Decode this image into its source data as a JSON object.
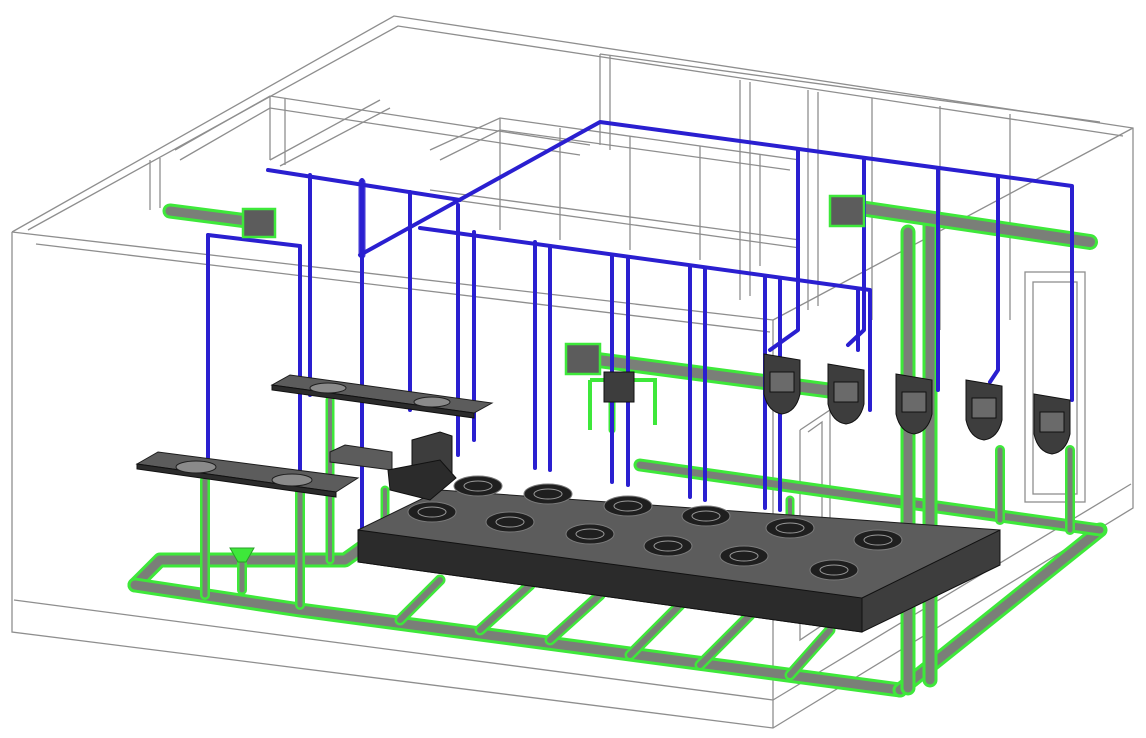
{
  "colors": {
    "background": "#ffffff",
    "wireframe": "#8e8e8e",
    "supply_pipe": "#2a1fd0",
    "drain_pipe_outline": "#3ee83a",
    "drain_pipe_fill": "#7a7f78",
    "fixture_dark": "#3d3d3d",
    "fixture_top": "#5c5c5c",
    "fixture_face": "#2b2b2b"
  },
  "legend": [
    {
      "system": "domestic-water-supply",
      "color": "#2a1fd0"
    },
    {
      "system": "sanitary-drain-vent",
      "color": "#3ee83a"
    }
  ],
  "fixtures": {
    "lavatory_counters": 2,
    "lavatories": 4,
    "water_closet": 1,
    "floor_fixtures": 12,
    "urinals": 5,
    "water_heaters": 3
  }
}
